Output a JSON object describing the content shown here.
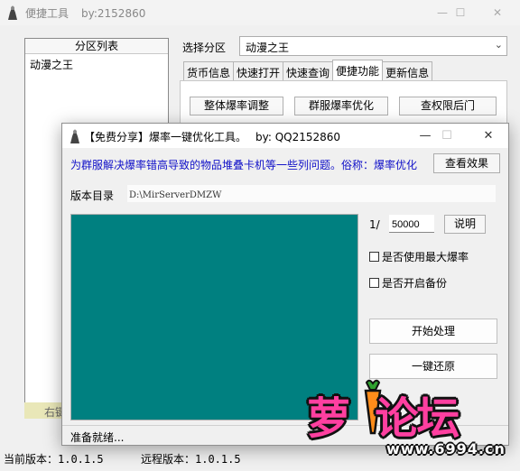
{
  "main_window": {
    "title": "便捷工具",
    "subtitle": "by:2152860",
    "controls": {
      "minimize": "—",
      "maximize": "☐",
      "close": "✕"
    },
    "left_panel": {
      "header": "分区列表",
      "items": [
        "动漫之王"
      ],
      "bottom_label": "右键"
    },
    "select_label": "选择分区",
    "selected_zone": "动漫之王",
    "tabs": [
      "货币信息",
      "快速打开",
      "快速查询",
      "便捷功能",
      "更新信息"
    ],
    "active_tab": "便捷功能",
    "tab_buttons": [
      "整体爆率调整",
      "群服爆率优化",
      "查权限后门"
    ],
    "status_current": "当前版本：1.0.1.5",
    "status_remote": "远程版本：1.0.1.5"
  },
  "dialog": {
    "title": "【免费分享】爆率一键优化工具。",
    "subtitle": "by: QQ2152860",
    "controls": {
      "minimize": "—",
      "maximize": "☐",
      "close": "✕"
    },
    "description": "为群服解决爆率错高导致的物品堆叠卡机等一些列问题。俗称：爆率优化",
    "effect_button": "查看效果",
    "version_dir_label": "版本目录",
    "version_dir_value": "D:\\MirServerDMZW",
    "log_color": "#008080",
    "ratio_prefix": "1/",
    "ratio_value": "50000",
    "explain_button": "说明",
    "checkboxes": [
      {
        "label": "是否使用最大爆率",
        "checked": false
      },
      {
        "label": "是否开启备份",
        "checked": false
      }
    ],
    "start_button": "开始处理",
    "restore_button": "一键还原",
    "status": "准备就绪..."
  },
  "watermark": {
    "text": "萝卜论坛",
    "url": "www.6994.cn"
  }
}
